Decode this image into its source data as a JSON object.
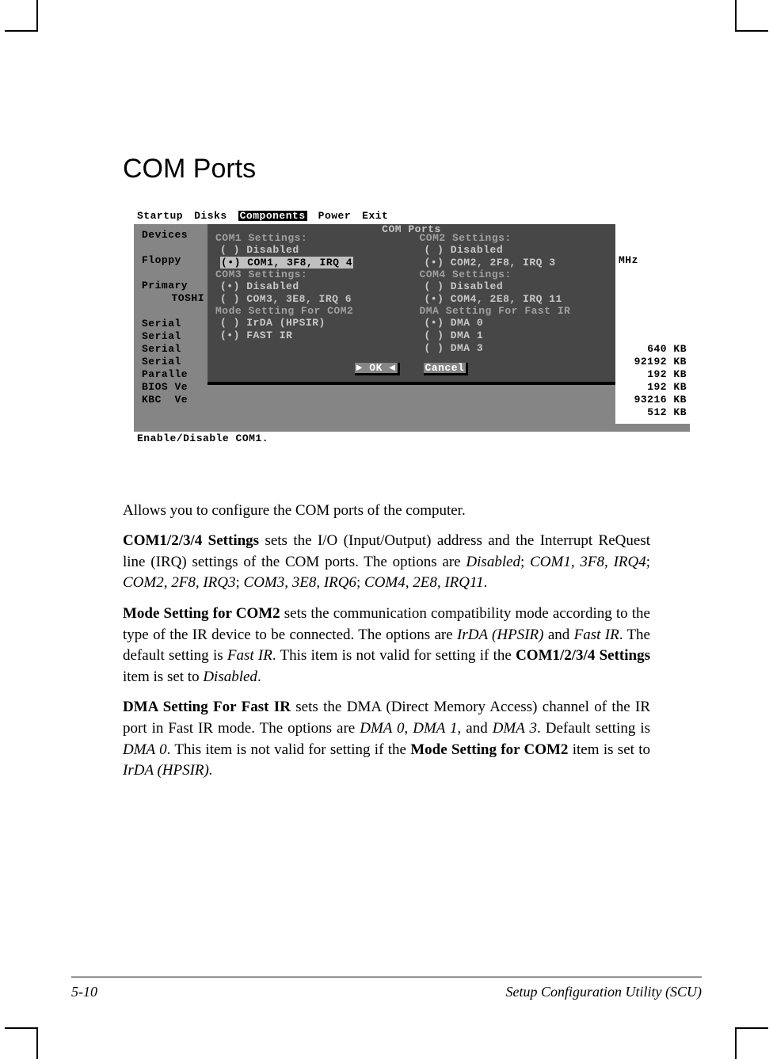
{
  "page": {
    "title": "COM Ports",
    "footer_left": "5-10",
    "footer_right": "Setup Configuration Utility (SCU)"
  },
  "bios": {
    "menubar": [
      "Startup",
      "Disks",
      "Components",
      "Power",
      "Exit"
    ],
    "menubar_selected_index": 2,
    "dialog_title": "COM Ports",
    "status_text": "Enable/Disable COM1.",
    "left_items": [
      "Devices",
      "",
      "Floppy",
      "",
      "Primary",
      "TOSHI",
      "",
      "Serial",
      "Serial",
      "Serial",
      "Serial",
      "Paralle",
      "BIOS Ve",
      "KBC  Ve"
    ],
    "right_items": [
      "",
      "",
      "MHz",
      "",
      "",
      "",
      "",
      "",
      "",
      "640 KB",
      "92192 KB",
      "192 KB",
      "192 KB",
      "93216 KB",
      "512 KB"
    ],
    "groups": {
      "com1": {
        "legend": "COM1 Settings:",
        "opts": [
          "( ) Disabled",
          "(•) COM1, 3F8, IRQ 4"
        ],
        "highlight_index": 1
      },
      "com2": {
        "legend": "COM2 Settings:",
        "opts": [
          "( ) Disabled",
          "(•) COM2, 2F8, IRQ 3"
        ]
      },
      "com3": {
        "legend": "COM3 Settings:",
        "opts": [
          "(•) Disabled",
          "( ) COM3, 3E8, IRQ 6"
        ]
      },
      "com4": {
        "legend": "COM4 Settings:",
        "opts": [
          "( ) Disabled",
          "(•) COM4, 2E8, IRQ 11"
        ]
      },
      "mode": {
        "legend": "Mode Setting For COM2",
        "opts": [
          "( ) IrDA (HPSIR)",
          "(•) FAST IR"
        ]
      },
      "dma": {
        "legend": "DMA Setting For Fast IR",
        "opts": [
          "(•) DMA 0",
          "( ) DMA 1",
          "( ) DMA 3"
        ]
      }
    },
    "buttons": {
      "ok": "OK",
      "cancel": "Cancel"
    }
  },
  "body": {
    "intro": "Allows you to configure the COM ports of the computer.",
    "defs": [
      {
        "head": "COM1/2/3/4 Settings",
        "text_a": " sets the I/O (Input/Output) address and the Interrupt ReQuest line (IRQ) settings of the COM ports. The options are ",
        "it_a": "Disabled",
        "sep1": "; ",
        "it_b": "COM1, 3F8, IRQ4",
        "sep2": "; ",
        "it_c": "COM2, 2F8, IRQ3",
        "sep3": "; ",
        "it_d": "COM3, 3E8",
        "sep4": ", ",
        "it_e": "IRQ6",
        "sep5": "; ",
        "it_f": "COM4, 2E8, IRQ11",
        "tail": "."
      },
      {
        "head": "Mode Setting for COM2",
        "text_a": " sets the communication compatibility mode according to the type of the IR device to be connected. The options are ",
        "it_a": "IrDA (HPSIR)",
        "sep1": " and ",
        "it_b": "Fast IR",
        "text_b": ". The default setting is ",
        "it_c": "Fast IR",
        "text_c": ". This item is not valid for setting if the ",
        "bold_a": "COM1/2/3/4 Settings",
        "text_d": " item is set to ",
        "it_d": "Disabled",
        "tail": "."
      },
      {
        "head": "DMA Setting For Fast IR",
        "text_a": " sets the DMA (Direct Memory Access) channel of the IR port in Fast IR mode. The options are ",
        "it_a": "DMA 0",
        "sep1": ", ",
        "it_b": "DMA 1",
        "sep2": ", and ",
        "it_c": "DMA 3",
        "text_b": ". Default setting is ",
        "it_d": "DMA 0",
        "text_c": ". This item is not valid for setting if the ",
        "bold_a": "Mode Setting for COM2",
        "text_d": " item is set to ",
        "it_e": "IrDA (HPSIR).",
        "tail": ""
      }
    ]
  }
}
